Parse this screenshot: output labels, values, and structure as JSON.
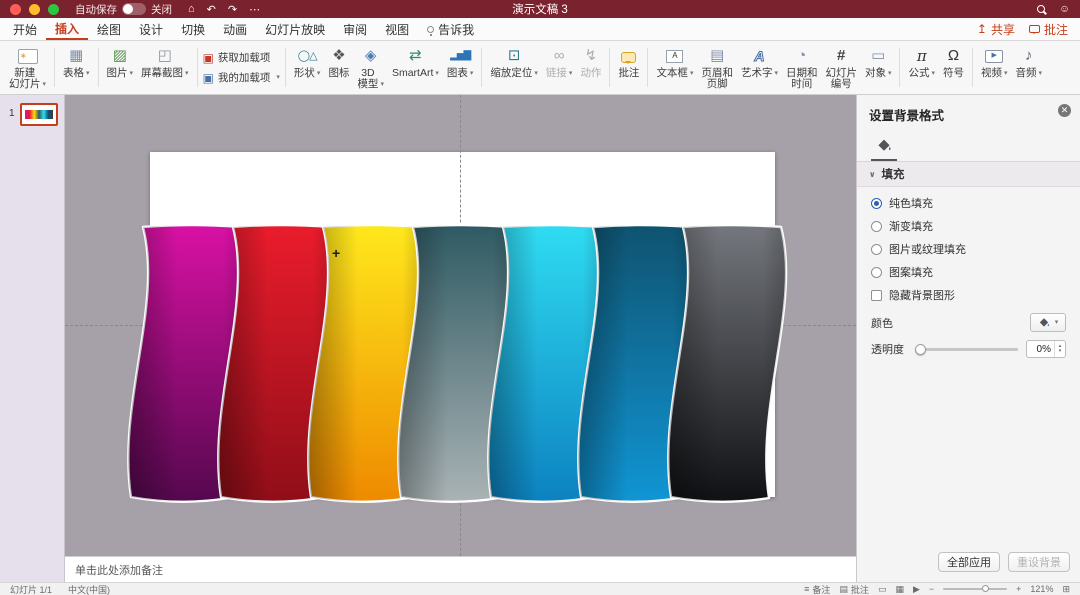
{
  "titlebar": {
    "autosave_label": "自动保存",
    "autosave_state": "关闭",
    "title": "演示文稿 3"
  },
  "tabs": {
    "home": "开始",
    "insert": "插入",
    "draw": "绘图",
    "design": "设计",
    "transitions": "切换",
    "animations": "动画",
    "slideshow": "幻灯片放映",
    "review": "审阅",
    "view": "视图",
    "tellme": "告诉我",
    "active_tab": "插入",
    "share": "共享",
    "comments": "批注"
  },
  "ribbon": {
    "new_slide": "新建\n幻灯片",
    "table": "表格",
    "pictures": "图片",
    "screenshot": "屏幕截图",
    "get_addins": "获取加载项",
    "my_addins": "我的加载项",
    "shapes": "形状",
    "icons": "图标",
    "model_3d": "3D\n模型",
    "smartart": "SmartArt",
    "chart": "图表",
    "zoom_sections": "缩放定位",
    "link": "链接",
    "action": "动作",
    "comment": "批注",
    "text_box": "文本框",
    "header_footer": "页眉和\n页脚",
    "wordart": "艺术字",
    "date_time": "日期和\n时间",
    "slide_number": "幻灯片\n编号",
    "object": "对象",
    "equation": "公式",
    "symbol": "符号",
    "video": "视频",
    "audio": "音频"
  },
  "slides_panel": {
    "slide_number": "1"
  },
  "slide": {
    "ribbons": [
      {
        "name": "magenta",
        "top": "#d911a4",
        "bottom": "#55084e"
      },
      {
        "name": "red",
        "top": "#ea1c2c",
        "bottom": "#8f0e18"
      },
      {
        "name": "yellow",
        "top": "#ffe81c",
        "bottom": "#ee8a00"
      },
      {
        "name": "slate-teal",
        "top": "#2f5a63",
        "bottom": "#aab3b5"
      },
      {
        "name": "cyan",
        "top": "#30dcf2",
        "bottom": "#0c82c0"
      },
      {
        "name": "deep-blue",
        "top": "#0f5370",
        "bottom": "#1095d4"
      },
      {
        "name": "charcoal",
        "top": "#74777d",
        "bottom": "#101114"
      }
    ]
  },
  "format_panel": {
    "title": "设置背景格式",
    "fill_section": "填充",
    "options": {
      "solid": "纯色填充",
      "gradient": "渐变填充",
      "picture": "图片或纹理填充",
      "pattern": "图案填充"
    },
    "selected_option": "纯色填充",
    "hide_bg": "隐藏背景图形",
    "color_label": "颜色",
    "transparency_label": "透明度",
    "transparency_value": "0%",
    "apply_all_label": "全部应用",
    "reset_label": "重设背景"
  },
  "notes": {
    "placeholder": "单击此处添加备注"
  },
  "statusbar": {
    "slide_info": "幻灯片 1/1",
    "language": "中文(中国)",
    "notes": "备注",
    "comments": "批注",
    "zoom": "121%"
  },
  "colors": {
    "titlebar_bg": "#7a222e",
    "accent": "#c43e1c",
    "canvas_bg": "#a6a1a8",
    "slides_panel_bg": "#e6dfec"
  }
}
